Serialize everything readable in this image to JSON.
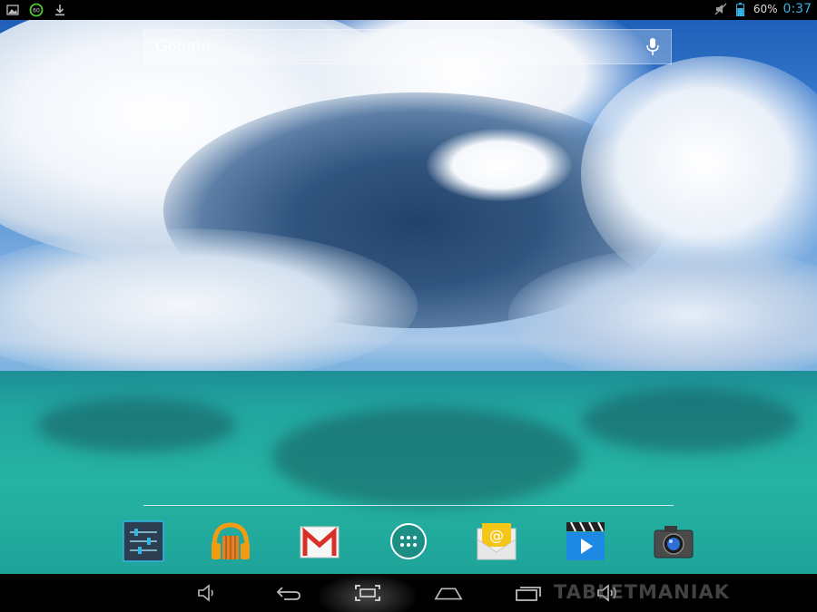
{
  "status_bar": {
    "left_icons": [
      "picture-icon",
      "gauge-icon",
      "download-icon"
    ],
    "gauge_text": "60",
    "right_icons": [
      "mute-icon",
      "battery-icon"
    ],
    "battery_percent": "60%",
    "time": "0:37"
  },
  "search": {
    "logo_text": "Google",
    "mic_icon": "microphone-icon"
  },
  "dock": {
    "apps": [
      "settings-app-icon",
      "play-music-app-icon",
      "gmail-app-icon",
      "all-apps-button",
      "email-app-icon",
      "video-player-app-icon",
      "camera-app-icon"
    ]
  },
  "nav_bar": {
    "buttons": [
      "volume-down-icon",
      "back-icon",
      "screenshot-icon",
      "home-icon",
      "recent-apps-icon",
      "volume-up-icon"
    ],
    "watermark": "TABLETMANIAK"
  },
  "colors": {
    "accent": "#33b5e5",
    "status_bg": "#000000"
  }
}
